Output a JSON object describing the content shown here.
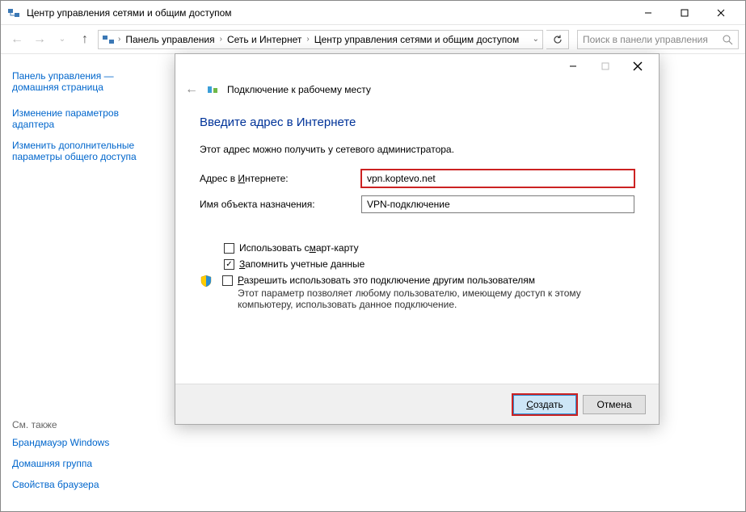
{
  "window": {
    "title": "Центр управления сетями и общим доступом"
  },
  "breadcrumb": {
    "seg1": "Панель управления",
    "seg2": "Сеть и Интернет",
    "seg3": "Центр управления сетями и общим доступом"
  },
  "search": {
    "placeholder": "Поиск в панели управления"
  },
  "sidebar": {
    "home": "Панель управления — домашняя страница",
    "link1": "Изменение параметров адаптера",
    "link2": "Изменить дополнительные параметры общего доступа",
    "seeAlsoHdr": "См. также",
    "see1": "Брандмауэр Windows",
    "see2": "Домашняя группа",
    "see3": "Свойства браузера"
  },
  "dialog": {
    "subheader": "Подключение к рабочему месту",
    "title": "Введите адрес в Интернете",
    "desc": "Этот адрес можно получить у сетевого администратора.",
    "addrLabelPre": "Адрес в ",
    "addrLabelU": "И",
    "addrLabelPost": "нтернете:",
    "addrValue": "vpn.koptevo.net",
    "destLabel": "Имя объекта назначения:",
    "destValue": "VPN-подключение",
    "chkSmartPre": "Использовать с",
    "chkSmartU": "м",
    "chkSmartPost": "арт-карту",
    "chkRememberU": "З",
    "chkRememberPost": "апомнить учетные данные",
    "chkShareU": "Р",
    "chkSharePost": "азрешить использовать это подключение другим пользователям",
    "chkShareSub": "Этот параметр позволяет любому пользователю, имеющему доступ к этому компьютеру, использовать данное подключение.",
    "btnCreateU": "С",
    "btnCreatePost": "оздать",
    "btnCancel": "Отмена"
  }
}
